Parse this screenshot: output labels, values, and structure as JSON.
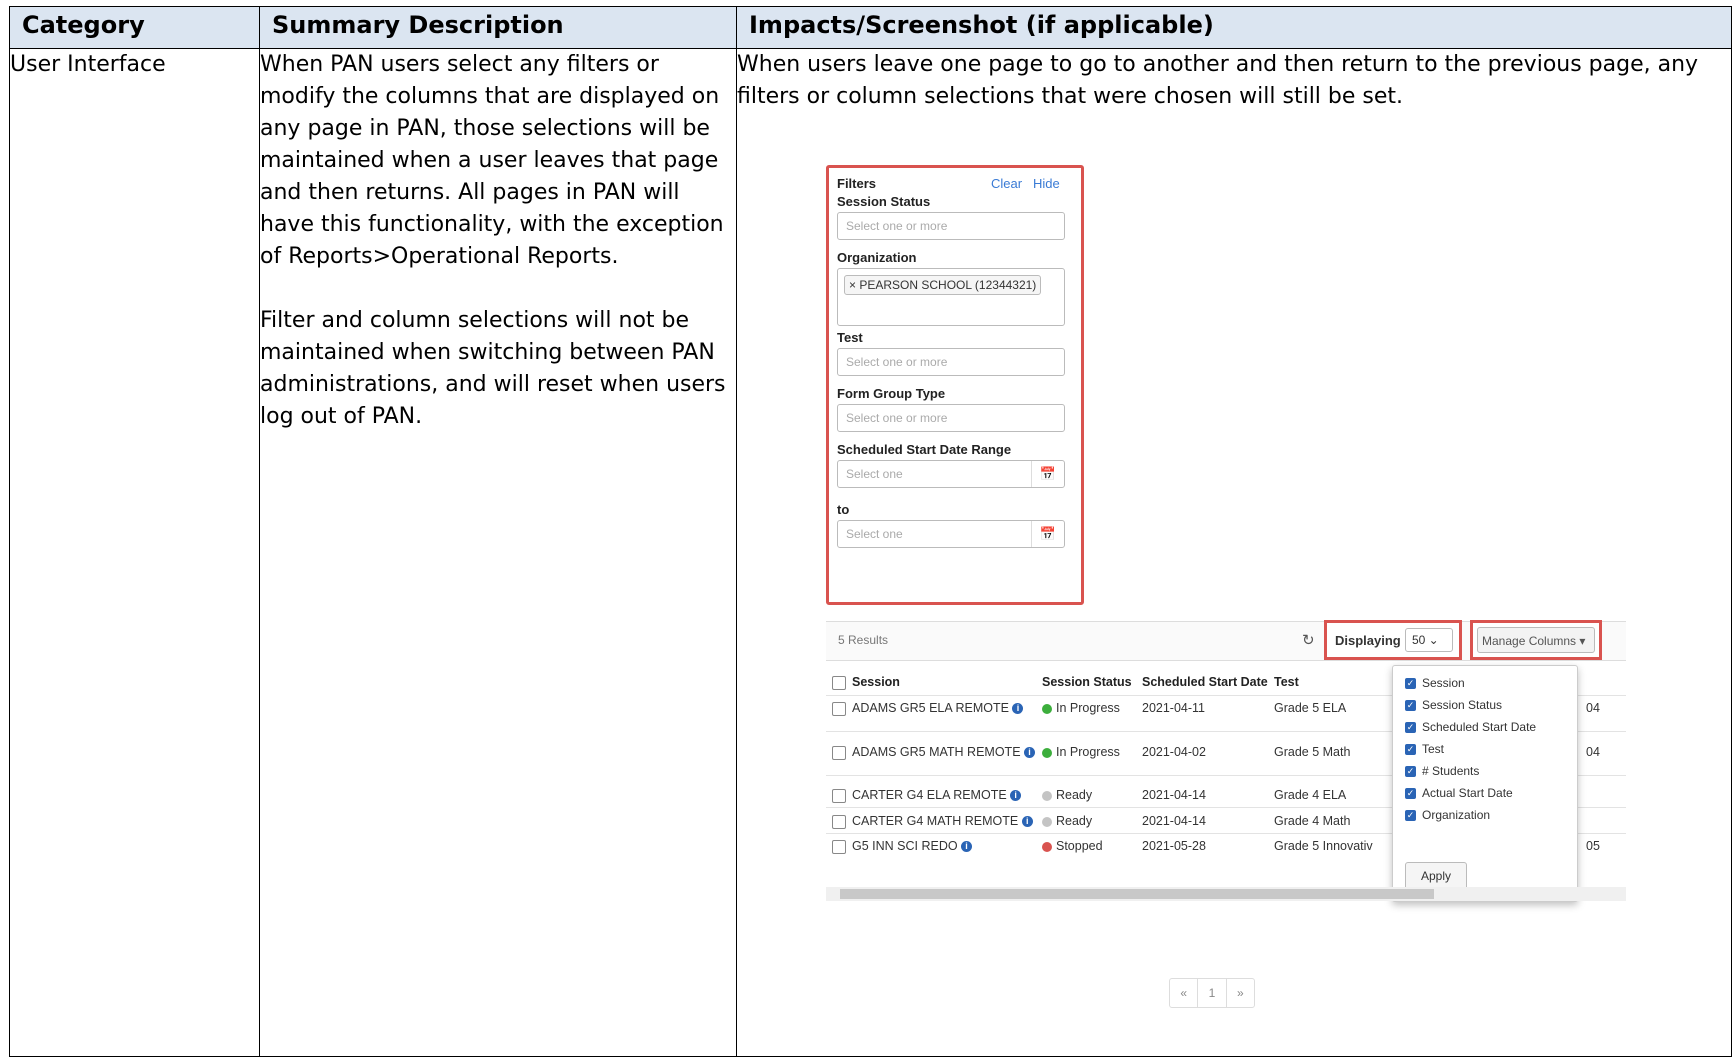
{
  "table": {
    "headers": [
      "Category",
      "Summary Description",
      "Impacts/Screenshot (if applicable)"
    ],
    "category": "User Interface",
    "summary_p1": "When PAN users select any filters or modify the columns that are displayed on any page in PAN, those selections will be maintained when a user leaves that page and then returns. All pages in PAN will have this functionality, with the exception of Reports>Operational Reports.",
    "summary_p2": "Filter and column selections will not be maintained when switching between PAN administrations, and will reset when users log out of PAN.",
    "impacts_text": "When users leave one page to go to another and then return to the previous page, any filters or column selections that were chosen will still be set."
  },
  "screenshot": {
    "filters": {
      "title": "Filters",
      "clear": "Clear",
      "hide": "Hide",
      "session_status_label": "Session Status",
      "session_status_placeholder": "Select one or more",
      "organization_label": "Organization",
      "organization_tag": "× PEARSON SCHOOL (12344321)",
      "test_label": "Test",
      "test_placeholder": "Select one or more",
      "form_group_label": "Form Group Type",
      "form_group_placeholder": "Select one or more",
      "date_range_label": "Scheduled Start Date Range",
      "start_placeholder": "Select one",
      "to_label": "to",
      "end_placeholder": "Select one",
      "calendar_icon": "📅"
    },
    "toolbar": {
      "results": "5 Results",
      "refresh_icon": "↻",
      "displaying_label": "Displaying",
      "displaying_value": "50 ⌄",
      "manage_columns": "Manage Columns ▾"
    },
    "grid": {
      "headers": [
        "Session",
        "Session Status",
        "Scheduled Start Date",
        "Test"
      ],
      "rows": [
        {
          "session": "ADAMS GR5 ELA REMOTE",
          "status": "In Progress",
          "date": "2021-04-11",
          "test": "Grade 5 ELA",
          "extra": "04"
        },
        {
          "session": "ADAMS GR5 MATH REMOTE",
          "status": "In Progress",
          "date": "2021-04-02",
          "test": "Grade 5 Math",
          "extra": "04"
        },
        {
          "session": "CARTER G4 ELA REMOTE",
          "status": "Ready",
          "date": "2021-04-14",
          "test": "Grade 4 ELA",
          "extra": ""
        },
        {
          "session": "CARTER G4 MATH REMOTE",
          "status": "Ready",
          "date": "2021-04-14",
          "test": "Grade 4 Math",
          "extra": ""
        },
        {
          "session": "G5 INN SCI REDO",
          "status": "Stopped",
          "date": "2021-05-28",
          "test": "Grade 5 Innovativ",
          "extra": "05"
        }
      ],
      "status_colors": {
        "in_progress": "#3cae3c",
        "ready": "#c4c4c4",
        "stopped": "#d9534f"
      }
    },
    "manage_columns_menu": {
      "items": [
        "Session",
        "Session Status",
        "Scheduled Start Date",
        "Test",
        "# Students",
        "Actual Start Date",
        "Organization"
      ],
      "apply": "Apply"
    },
    "pager": {
      "prev": "«",
      "page": "1",
      "next": "»"
    }
  }
}
